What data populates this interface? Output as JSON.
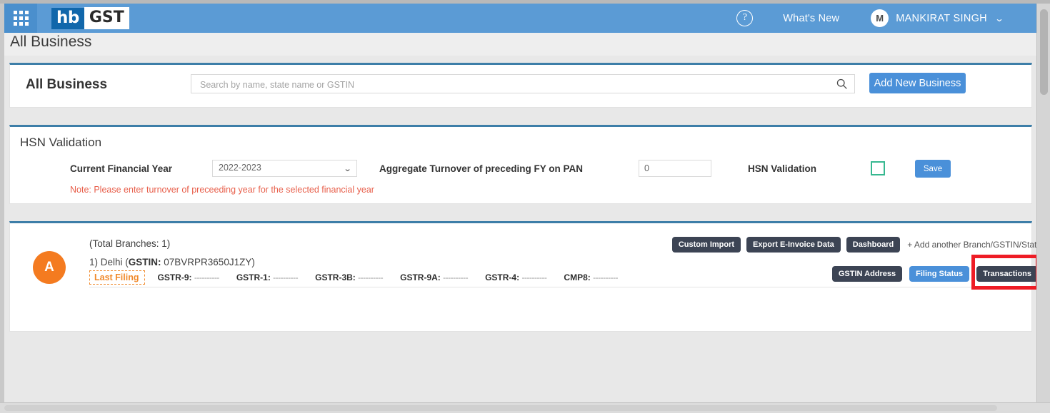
{
  "topbar": {
    "apps_icon": "grid-apps-icon",
    "logo_part1": "hb",
    "logo_part2": "GST",
    "help_icon": "?",
    "whats_new": "What's New",
    "avatar_initial": "M",
    "user_name": "MANKIRAT SINGH",
    "caret": "⌄",
    "bg_color": "#5b9bd5"
  },
  "page": {
    "title": "All Business"
  },
  "business_card": {
    "title": "All Business",
    "search_placeholder": "Search by name, state name or GSTIN",
    "search_value": "",
    "search_icon": "search-icon",
    "add_button": "Add New Business"
  },
  "hsn_card": {
    "title": "HSN Validation",
    "fy_label": "Current Financial Year",
    "fy_value": "2022-2023",
    "fy_caret": "⌄",
    "aggregate_label": "Aggregate Turnover of preceding FY on PAN",
    "aggregate_value": "0",
    "hsn_label": "HSN Validation",
    "hsn_checked": false,
    "save_button": "Save",
    "note": "Note: Please enter turnover of preceeding year for the selected financial year",
    "note_color": "#e8604c",
    "checkbox_color": "#37b890"
  },
  "branch_card": {
    "total_branches": "(Total Branches: 1)",
    "avatar_initial": "A",
    "avatar_color": "#f47b20",
    "branch_index": "1) Delhi (",
    "gstin_label": "GSTIN:",
    "gstin_value": " 07BVRPR3650J1ZY)",
    "last_filing_badge": "Last Filing",
    "filings": [
      {
        "label": "GSTR-9:",
        "value": "----------"
      },
      {
        "label": "GSTR-1:",
        "value": "----------"
      },
      {
        "label": "GSTR-3B:",
        "value": "----------"
      },
      {
        "label": "GSTR-9A:",
        "value": "----------"
      },
      {
        "label": "GSTR-4:",
        "value": "----------"
      },
      {
        "label": "CMP8:",
        "value": "----------"
      }
    ],
    "top_actions": {
      "custom_import": "Custom Import",
      "export_einvoice": "Export E-Invoice Data",
      "dashboard": "Dashboard",
      "add_another": "+ Add another Branch/GSTIN/State"
    },
    "row_actions": {
      "gstin_address": "GSTIN Address",
      "filing_status": "Filing Status",
      "transactions": "Transactions"
    },
    "highlight_color": "#ee1c25"
  }
}
